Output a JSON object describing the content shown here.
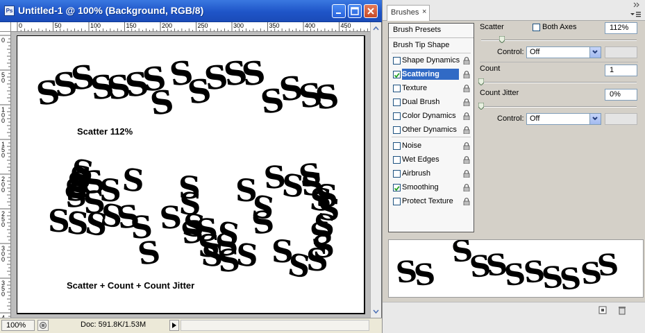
{
  "document": {
    "title": "Untitled-1 @ 100% (Background, RGB/8)",
    "app_icon_label": "Ps",
    "ruler_h_labels": [
      "0",
      "50",
      "100",
      "150",
      "200",
      "250",
      "300",
      "350",
      "400",
      "450"
    ],
    "ruler_v_labels": [
      "0",
      "50",
      "100",
      "150",
      "200",
      "250",
      "300",
      "350",
      "400"
    ],
    "caption_top": "Scatter 112%",
    "caption_bottom": "Scatter + Count + Count Jitter",
    "stroke_glyph": "S",
    "zoom": "100%",
    "doc_info": "Doc: 591.8K/1.53M"
  },
  "brushes_panel": {
    "tab_label": "Brushes",
    "close_label": "×",
    "presets_label": "Brush Presets",
    "tip_shape_label": "Brush Tip Shape",
    "options": [
      {
        "label": "Shape Dynamics",
        "checked": false,
        "selected": false
      },
      {
        "label": "Scattering",
        "checked": true,
        "selected": true
      },
      {
        "label": "Texture",
        "checked": false,
        "selected": false
      },
      {
        "label": "Dual Brush",
        "checked": false,
        "selected": false
      },
      {
        "label": "Color Dynamics",
        "checked": false,
        "selected": false
      },
      {
        "label": "Other Dynamics",
        "checked": false,
        "selected": false
      },
      {
        "label": "Noise",
        "checked": false,
        "selected": false
      },
      {
        "label": "Wet Edges",
        "checked": false,
        "selected": false
      },
      {
        "label": "Airbrush",
        "checked": false,
        "selected": false
      },
      {
        "label": "Smoothing",
        "checked": true,
        "selected": false
      },
      {
        "label": "Protect Texture",
        "checked": false,
        "selected": false
      }
    ],
    "scatter": {
      "label": "Scatter",
      "both_axes_label": "Both Axes",
      "both_axes_checked": false,
      "value": "112%",
      "level": 0.112
    },
    "control_1": {
      "label": "Control:",
      "value": "Off"
    },
    "count": {
      "label": "Count",
      "value": "1",
      "level": 0.0
    },
    "count_jitter": {
      "label": "Count Jitter",
      "value": "0%",
      "level": 0.0
    },
    "control_2": {
      "label": "Control:",
      "value": "Off"
    }
  }
}
